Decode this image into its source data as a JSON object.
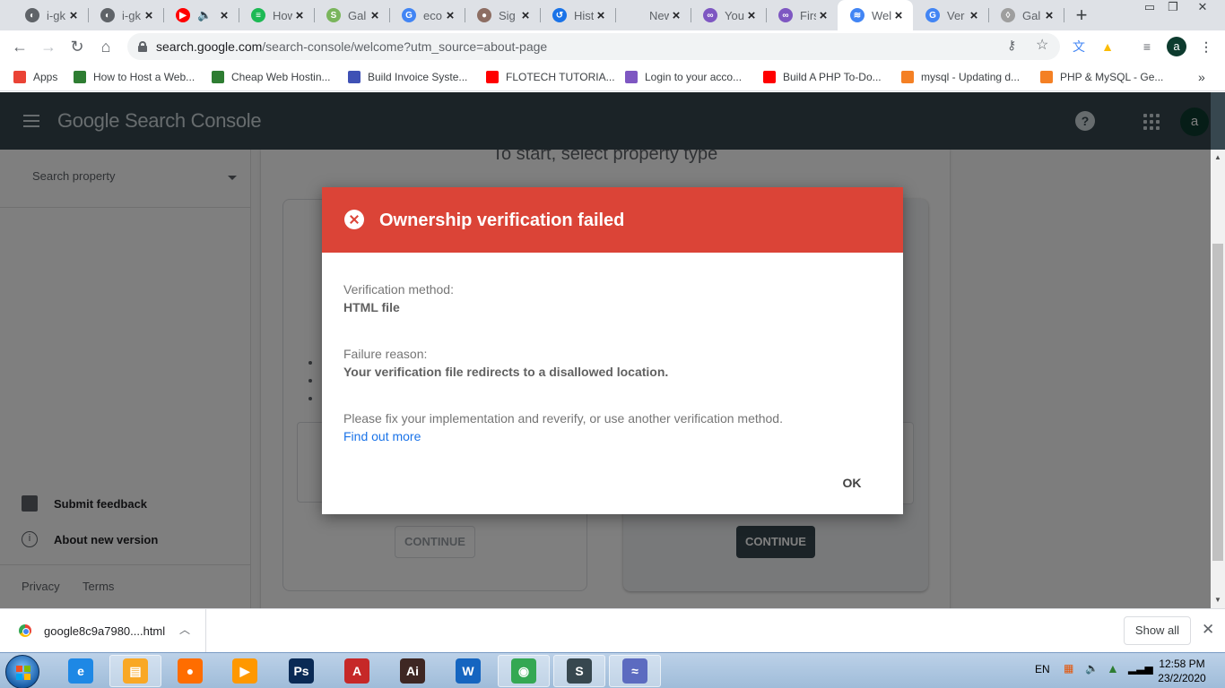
{
  "browser": {
    "tabs": [
      {
        "title": "i-gk",
        "favicon_color": "#5f6368",
        "glyph": "◐"
      },
      {
        "title": "i-gk",
        "favicon_color": "#5f6368",
        "glyph": "◐"
      },
      {
        "title": "",
        "favicon_color": "#ff0000",
        "glyph": "▶",
        "audio": "🔈"
      },
      {
        "title": "How",
        "favicon_color": "#1db954",
        "glyph": "≡"
      },
      {
        "title": "Gal",
        "favicon_color": "#7ab55c",
        "glyph": "S"
      },
      {
        "title": "eco",
        "favicon_color": "#4285f4",
        "glyph": "G"
      },
      {
        "title": "Sig",
        "favicon_color": "#8d6e63",
        "glyph": "●"
      },
      {
        "title": "Hist",
        "favicon_color": "#1a73e8",
        "glyph": "↺"
      },
      {
        "title": "New Tab",
        "favicon_color": "#dee1e6",
        "glyph": ""
      },
      {
        "title": "You",
        "favicon_color": "#7e57c2",
        "glyph": "∞"
      },
      {
        "title": "First",
        "favicon_color": "#7e57c2",
        "glyph": "∞"
      },
      {
        "title": "Wel",
        "favicon_color": "#4285f4",
        "glyph": "≋",
        "active": true
      },
      {
        "title": "Ver",
        "favicon_color": "#4285f4",
        "glyph": "G"
      },
      {
        "title": "Gal",
        "favicon_color": "#9e9e9e",
        "glyph": "◊"
      }
    ],
    "new_tab": "+",
    "url_host": "search.google.com",
    "url_rest": "/search-console/welcome?utm_source=about-page",
    "profile_initial": "a",
    "bookmarks": [
      {
        "label": "Apps",
        "color": "#ea4335"
      },
      {
        "label": "How to Host a Web...",
        "color": "#2e7d32"
      },
      {
        "label": "Cheap Web Hostin...",
        "color": "#2e7d32"
      },
      {
        "label": "Build Invoice Syste...",
        "color": "#3f51b5"
      },
      {
        "label": "FLOTECH TUTORIA...",
        "color": "#ff0000"
      },
      {
        "label": "Login to your acco...",
        "color": "#7e57c2"
      },
      {
        "label": "Build A PHP To-Do...",
        "color": "#ff0000"
      },
      {
        "label": "mysql - Updating d...",
        "color": "#f48024"
      },
      {
        "label": "PHP & MySQL - Ge...",
        "color": "#f48024"
      }
    ],
    "bookmarks_more": "»"
  },
  "gsc": {
    "logo": "Google Search Console",
    "help": "?",
    "avatar": "a",
    "search_property": "Search property",
    "submit_feedback": "Submit feedback",
    "about_new_version": "About new version",
    "privacy": "Privacy",
    "terms": "Terms",
    "start_title": "To start, select property type",
    "continue_left": "CONTINUE",
    "continue_right": "CONTINUE"
  },
  "modal": {
    "title": "Ownership verification failed",
    "method_label": "Verification method:",
    "method_value": "HTML file",
    "reason_label": "Failure reason:",
    "reason_value": "Your verification file redirects to a disallowed location.",
    "instructions": "Please fix your implementation and reverify, or use another verification method.",
    "link": "Find out more",
    "ok": "OK",
    "header_color": "#db4437"
  },
  "downloads": {
    "file": "google8c9a7980....html",
    "show_all": "Show all"
  },
  "taskbar": {
    "apps": [
      {
        "name": "internet-explorer",
        "label": "e",
        "color": "#1e88e5",
        "open": false
      },
      {
        "name": "file-explorer",
        "label": "▤",
        "color": "#f9a825",
        "open": true
      },
      {
        "name": "firefox",
        "label": "●",
        "color": "#ff6d00",
        "open": false
      },
      {
        "name": "media-player",
        "label": "▶",
        "color": "#ff9800",
        "open": false
      },
      {
        "name": "photoshop",
        "label": "Ps",
        "color": "#0a2a55",
        "open": false
      },
      {
        "name": "acrobat",
        "label": "A",
        "color": "#c62828",
        "open": false
      },
      {
        "name": "illustrator",
        "label": "Ai",
        "color": "#3e2723",
        "open": false
      },
      {
        "name": "word",
        "label": "W",
        "color": "#1565c0",
        "open": false
      },
      {
        "name": "chrome",
        "label": "◉",
        "color": "#34a853",
        "open": true
      },
      {
        "name": "sublime-text",
        "label": "S",
        "color": "#37474f",
        "open": true
      },
      {
        "name": "mysql-workbench",
        "label": "≈",
        "color": "#5c6bc0",
        "open": true
      }
    ],
    "language": "EN",
    "time": "12:58 PM",
    "date": "23/2/2020"
  }
}
